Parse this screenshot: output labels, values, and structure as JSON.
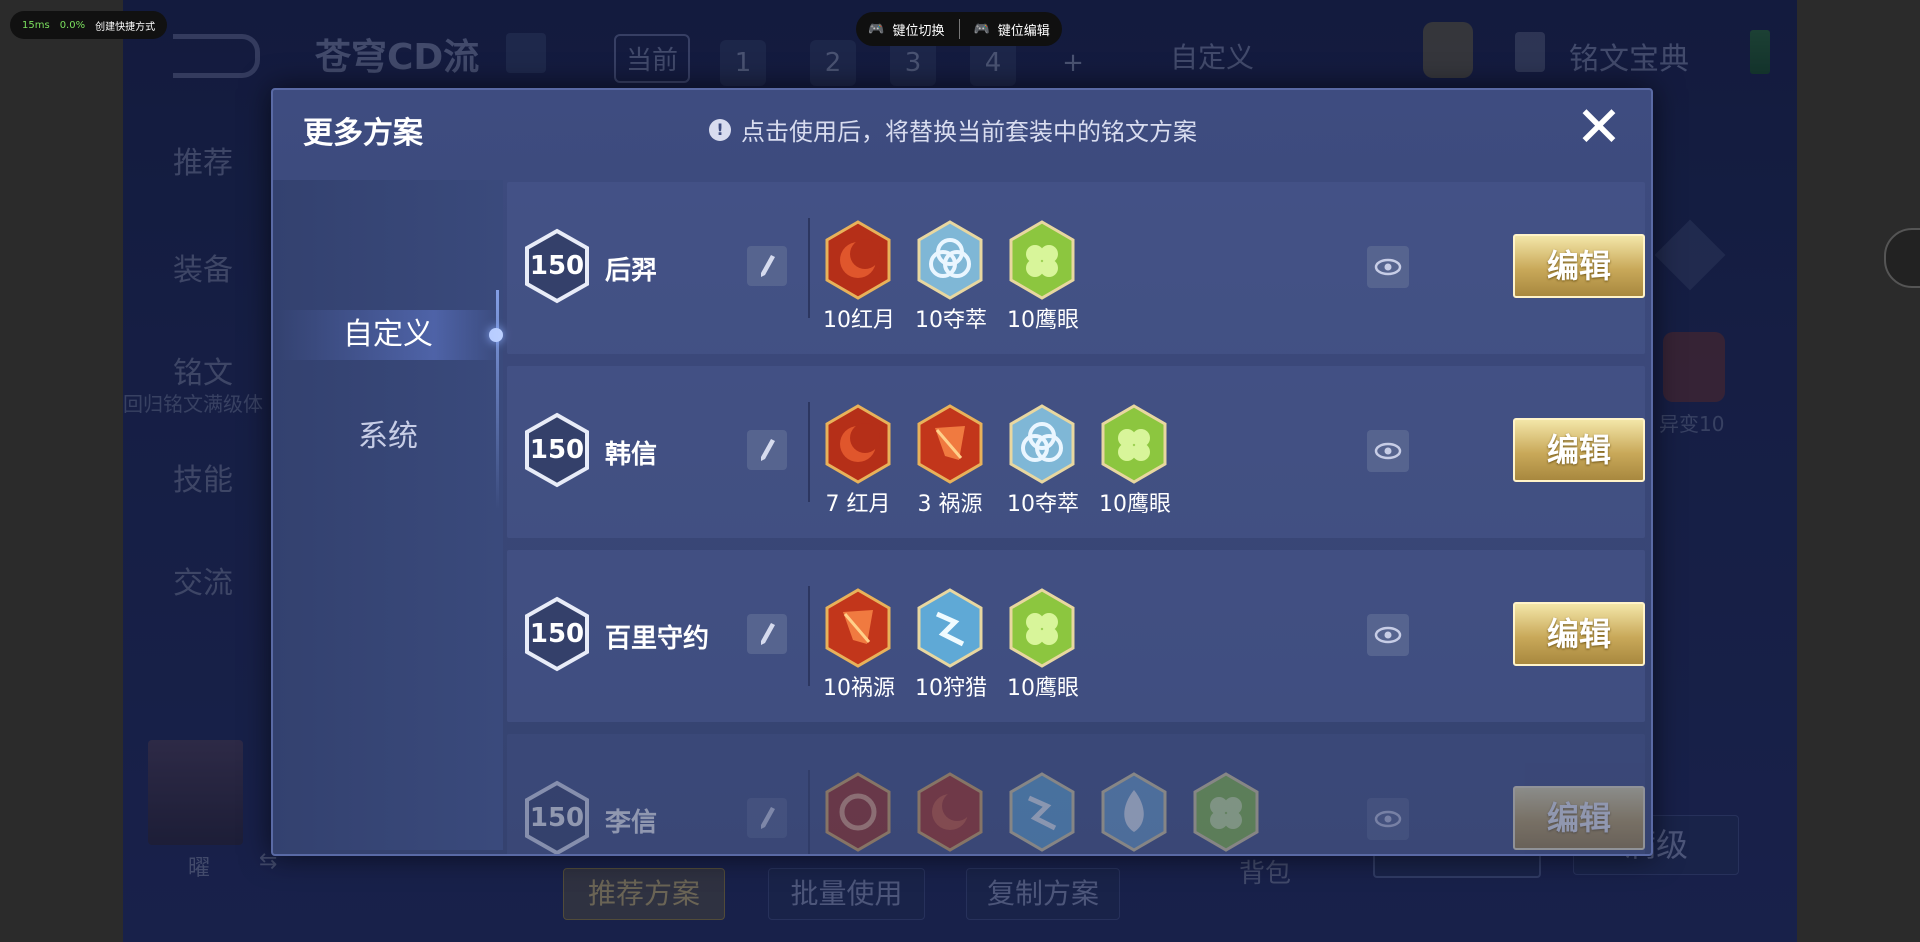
{
  "overlay": {
    "ping": "15ms",
    "loss": "0.0%",
    "shortcut_label": "创建快捷方式",
    "key_switch": "键位切换",
    "key_edit": "键位编辑"
  },
  "background": {
    "set_name": "苍穹CD流",
    "tab_current": "当前",
    "tabs": [
      "1",
      "2",
      "3",
      "4",
      "+"
    ],
    "tab_custom": "自定义",
    "codex": "铭文宝典",
    "left_menu": [
      "推荐",
      "装备",
      "铭文",
      "技能",
      "交流"
    ],
    "inscription_sub": "回归铭文满级体",
    "bottom_buttons": [
      "推荐方案",
      "批量使用",
      "复制方案"
    ],
    "bag": "背包",
    "max_level": "满级",
    "right_gem_label": "异变10",
    "hero_badge": "曜"
  },
  "dialog": {
    "title": "更多方案",
    "notice": "点击使用后，将替换当前套装中的铭文方案",
    "close_icon": "close-icon",
    "tabs": [
      "自定义",
      "系统"
    ],
    "active_tab": "自定义",
    "edit_label": "编辑",
    "rows": [
      {
        "level": "150",
        "hero": "后羿",
        "gems": [
          {
            "label": "10红月",
            "kind": "red-moon"
          },
          {
            "label": "10夺萃",
            "kind": "blue-knot"
          },
          {
            "label": "10鹰眼",
            "kind": "green-clover"
          }
        ]
      },
      {
        "level": "150",
        "hero": "韩信",
        "gems": [
          {
            "label": "7 红月",
            "kind": "red-moon"
          },
          {
            "label": "3 祸源",
            "kind": "red-shard"
          },
          {
            "label": "10夺萃",
            "kind": "blue-knot"
          },
          {
            "label": "10鹰眼",
            "kind": "green-clover"
          }
        ]
      },
      {
        "level": "150",
        "hero": "百里守约",
        "gems": [
          {
            "label": "10祸源",
            "kind": "red-shard"
          },
          {
            "label": "10狩猎",
            "kind": "blue-bolt"
          },
          {
            "label": "10鹰眼",
            "kind": "green-clover"
          }
        ]
      },
      {
        "level": "150",
        "hero": "李信",
        "gems": [
          {
            "label": "",
            "kind": "red-ring"
          },
          {
            "label": "",
            "kind": "red-moon"
          },
          {
            "label": "",
            "kind": "blue-bolt"
          },
          {
            "label": "",
            "kind": "blue-flame"
          },
          {
            "label": "",
            "kind": "green-clover"
          }
        ]
      }
    ]
  },
  "colors": {
    "gold_button": "#c9a95a",
    "panel": "#3e4c80",
    "red_gem": "#c2361b",
    "blue_gem": "#8fc6e0",
    "green_gem": "#8cc63f"
  }
}
